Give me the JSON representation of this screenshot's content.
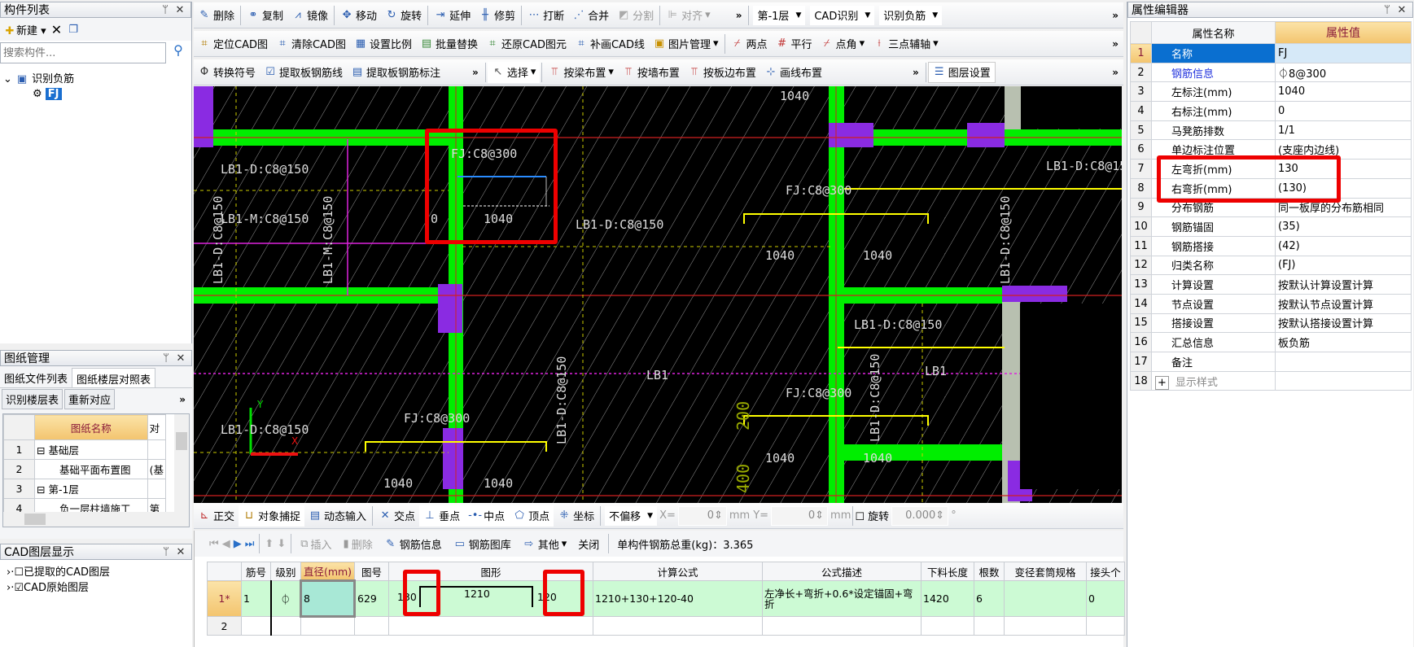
{
  "component_list": {
    "title": "构件列表",
    "new_label": "新建",
    "search_placeholder": "搜索构件...",
    "tree": [
      {
        "label": "识别负筋"
      },
      {
        "label": "FJ"
      }
    ]
  },
  "toolbar_row1": {
    "items": [
      "删除",
      "复制",
      "镜像",
      "移动",
      "旋转",
      "延伸",
      "修剪",
      "打断",
      "合并",
      "分割",
      "对齐"
    ],
    "floor": "第-1层",
    "mode": "CAD识别",
    "component": "识别负筋"
  },
  "toolbar_row2": {
    "items": [
      "定位CAD图",
      "清除CAD图",
      "设置比例",
      "批量替换",
      "还原CAD图元",
      "补画CAD线",
      "图片管理",
      "两点",
      "平行",
      "点角",
      "三点辅轴"
    ]
  },
  "toolbar_row3": {
    "items": [
      "转换符号",
      "提取板钢筋线",
      "提取板钢筋标注",
      "选择",
      "按梁布置",
      "按墙布置",
      "按板边布置",
      "画线布置"
    ],
    "layer_settings": "图层设置"
  },
  "drawing_manager": {
    "title": "图纸管理",
    "tabs": [
      "图纸文件列表",
      "图纸楼层对照表"
    ],
    "active_tab": 1,
    "buttons": [
      "识别楼层表",
      "重新对应"
    ],
    "column": "图纸名称",
    "column2": "对",
    "rows": [
      {
        "no": "1",
        "name": "基础层",
        "c2": ""
      },
      {
        "no": "2",
        "name": "基础平面布置图",
        "c2": "(基"
      },
      {
        "no": "3",
        "name": "第-1层",
        "c2": ""
      },
      {
        "no": "4",
        "name": "负一层柱墙施工",
        "c2": "第"
      }
    ]
  },
  "cad_layers": {
    "title": "CAD图层显示",
    "items": [
      {
        "label": "已提取的CAD图层",
        "checked": false
      },
      {
        "label": "CAD原始图层",
        "checked": true
      }
    ]
  },
  "canvas": {
    "labels": [
      "1040",
      "FJ:C8@300",
      "LB1-D:C8@150",
      "LB1-M:C8@150",
      "0",
      "1040",
      "LB1-D:C8@150",
      "1040",
      "1040",
      "FJ:C8@300",
      "LB1-D:C8@150",
      "LB1-D:C8@150",
      "LB1",
      "LB1",
      "FJ:C8@300",
      "FJ:C8@300",
      "LB1-D:C8@150",
      "1040",
      "1040",
      "1040",
      "1040",
      "200",
      "400"
    ],
    "vlabels": [
      "LB1-D:C8@150",
      "LB1-M:C8@150",
      "LB1-D:C8@150",
      "LB1-D:C8@150",
      "LB1-D:C8@150"
    ],
    "axis_x": "X",
    "axis_y": "Y",
    "colors": {
      "background": "#000000",
      "wall": "#00ee00",
      "highlight": "#ee0000",
      "rebar": "#ffff00"
    }
  },
  "snap_toolbar": {
    "items": [
      "正交",
      "对象捕捉",
      "动态输入",
      "交点",
      "垂点",
      "中点",
      "顶点",
      "坐标"
    ],
    "offset": "不偏移",
    "x_label": "X=",
    "x_value": "0",
    "y_label": "Y=",
    "y_value": "0",
    "unit": "mm",
    "rotate_label": "旋转",
    "rotate_value": "0.000",
    "deg": "°"
  },
  "rebar_toolbar": {
    "insert": "插入",
    "delete": "删除",
    "info": "钢筋信息",
    "library": "钢筋图库",
    "other": "其他",
    "close": "关闭",
    "total_weight": "单构件钢筋总重(kg)：3.365"
  },
  "rebar_table": {
    "columns": [
      "",
      "筋号",
      "级别",
      "直径(mm)",
      "图号",
      "图形",
      "计算公式",
      "公式描述",
      "下料长度",
      "根数",
      "变径套筒规格",
      "接头个"
    ],
    "rows": [
      {
        "idx": "1*",
        "no": "1",
        "grade": "⏀",
        "dia": "8",
        "shape_no": "629",
        "shape_left": "130",
        "shape_mid": "1210",
        "shape_right": "120",
        "formula": "1210+130+120-40",
        "desc": "左净长+弯折+0.6*设定锚固+弯折",
        "length": "1420",
        "count": "6",
        "sleeve": "",
        "joints": "0"
      },
      {
        "idx": "2"
      }
    ]
  },
  "properties": {
    "title": "属性编辑器",
    "col_name": "属性名称",
    "col_value": "属性值",
    "rows": [
      {
        "n": "1",
        "name": "名称",
        "value": "FJ"
      },
      {
        "n": "2",
        "name": "钢筋信息",
        "value": "⏀8@300"
      },
      {
        "n": "3",
        "name": "左标注(mm)",
        "value": "1040"
      },
      {
        "n": "4",
        "name": "右标注(mm)",
        "value": "0"
      },
      {
        "n": "5",
        "name": "马凳筋排数",
        "value": "1/1"
      },
      {
        "n": "6",
        "name": "单边标注位置",
        "value": "(支座内边线)"
      },
      {
        "n": "7",
        "name": "左弯折(mm)",
        "value": "130"
      },
      {
        "n": "8",
        "name": "右弯折(mm)",
        "value": "(130)"
      },
      {
        "n": "9",
        "name": "分布钢筋",
        "value": "同一板厚的分布筋相同"
      },
      {
        "n": "10",
        "name": "钢筋锚固",
        "value": "(35)"
      },
      {
        "n": "11",
        "name": "钢筋搭接",
        "value": "(42)"
      },
      {
        "n": "12",
        "name": "归类名称",
        "value": "(FJ)"
      },
      {
        "n": "13",
        "name": "计算设置",
        "value": "按默认计算设置计算"
      },
      {
        "n": "14",
        "name": "节点设置",
        "value": "按默认节点设置计算"
      },
      {
        "n": "15",
        "name": "搭接设置",
        "value": "按默认搭接设置计算"
      },
      {
        "n": "16",
        "name": "汇总信息",
        "value": "板负筋"
      },
      {
        "n": "17",
        "name": "备注",
        "value": ""
      },
      {
        "n": "18",
        "name": "显示样式",
        "value": ""
      }
    ]
  }
}
